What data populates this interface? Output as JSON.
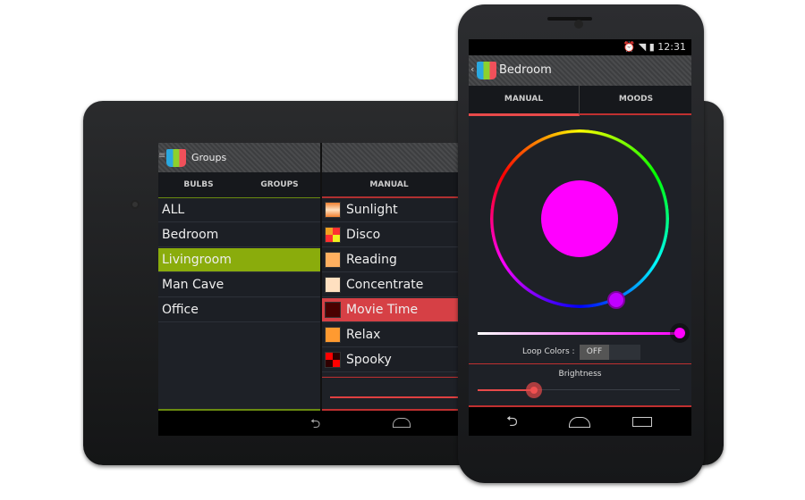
{
  "tablet": {
    "title": "Groups",
    "tabs": [
      {
        "label": "BULBS",
        "active": false
      },
      {
        "label": "GROUPS",
        "active": true
      }
    ],
    "right_tab": "MANUAL",
    "groups": [
      {
        "label": "ALL"
      },
      {
        "label": "Bedroom"
      },
      {
        "label": "Livingroom",
        "selected": true
      },
      {
        "label": "Man Cave"
      },
      {
        "label": "Office"
      }
    ],
    "moods": [
      {
        "label": "Sunlight",
        "swatch": "linear-gradient(#f08030,#ffe0c0,#f08030)"
      },
      {
        "label": "Disco",
        "swatch": "conic-gradient(#ff3030 0 25%,#f0f020 0 50%,#ff3030 0 75%,#f0a020 0)"
      },
      {
        "label": "Reading",
        "swatch": "#ffb060"
      },
      {
        "label": "Concentrate",
        "swatch": "#ffe0c0"
      },
      {
        "label": "Movie Time",
        "swatch": "#4a0000",
        "selected": true
      },
      {
        "label": "Relax",
        "swatch": "#ff9a30"
      },
      {
        "label": "Spooky",
        "swatch": "conic-gradient(#300000 0 25%,#ff0000 0 50%,#300000 0 75%,#ff0000 0)"
      }
    ],
    "accent_green": "#8aac0c",
    "accent_red": "#d64045"
  },
  "phone": {
    "time": "12:31",
    "title": "Bedroom",
    "tabs": [
      {
        "label": "MANUAL",
        "active": true
      },
      {
        "label": "MOODS",
        "active": false
      }
    ],
    "selected_color": "#ff00ff",
    "saturation_percent": 100,
    "loop_colors_label": "Loop Colors :",
    "loop_colors_state": "OFF",
    "brightness_label": "Brightness",
    "brightness_percent": 28
  }
}
